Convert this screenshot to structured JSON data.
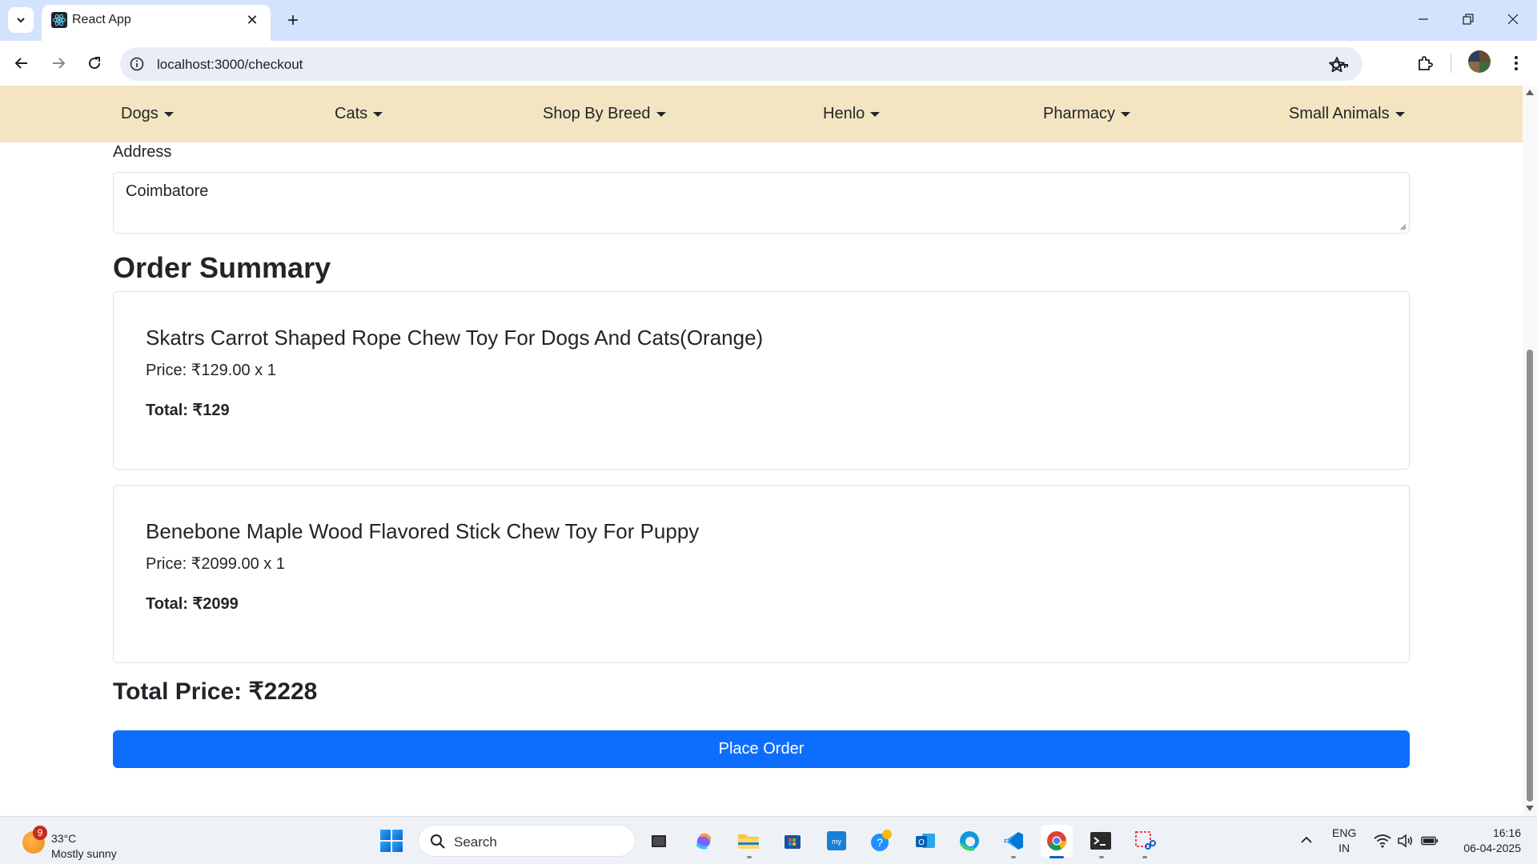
{
  "browser": {
    "tab_title": "React App",
    "url": "localhost:3000/checkout"
  },
  "site_nav": {
    "items": [
      "Dogs",
      "Cats",
      "Shop By Breed",
      "Henlo",
      "Pharmacy",
      "Small Animals"
    ]
  },
  "checkout": {
    "address_label": "Address",
    "address_value": "Coimbatore",
    "summary_heading": "Order Summary",
    "orders": [
      {
        "name": "Skatrs Carrot Shaped Rope Chew Toy For Dogs And Cats(Orange)",
        "price_line": "Price: ₹129.00 x 1",
        "total_line": "Total: ₹129"
      },
      {
        "name": "Benebone Maple Wood Flavored Stick Chew Toy For Puppy",
        "price_line": "Price: ₹2099.00 x 1",
        "total_line": "Total: ₹2099"
      }
    ],
    "total_price": "Total Price: ₹2228",
    "place_order_label": "Place Order"
  },
  "taskbar": {
    "weather_badge": "9",
    "weather_temp": "33°C",
    "weather_desc": "Mostly sunny",
    "search_label": "Search",
    "lang_line1": "ENG",
    "lang_line2": "IN",
    "time": "16:16",
    "date": "06-04-2025",
    "pinned_apps": [
      "file-explorer-icon",
      "copilot-icon",
      "folder-icon",
      "microsoft-store-icon",
      "mylio-icon",
      "help-icon",
      "outlook-icon",
      "edge-icon",
      "vscode-icon",
      "chrome-icon",
      "terminal-icon",
      "snipping-tool-icon"
    ]
  },
  "colors": {
    "nav_background": "#f3e5c1",
    "primary_button": "#0d6efd",
    "tabbar_background": "#d3e3fd"
  }
}
